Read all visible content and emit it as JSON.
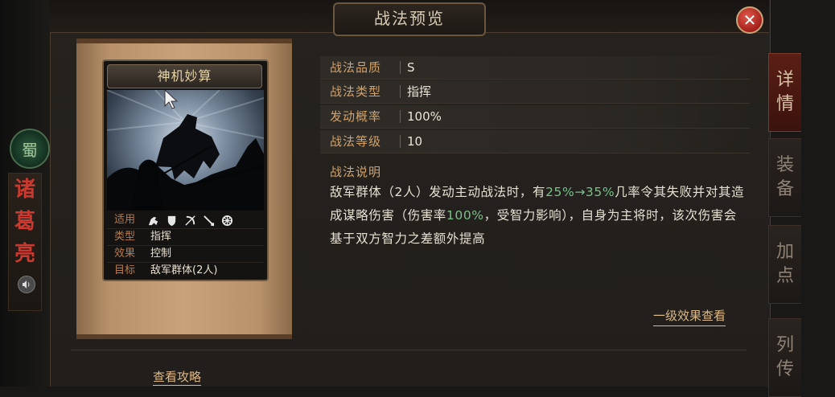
{
  "dialog": {
    "title": "战法预览",
    "close_icon": "close-icon"
  },
  "hero": {
    "faction_glyph": "蜀",
    "name_chars": [
      "诸",
      "葛",
      "亮"
    ],
    "voice_icon": "speaker-icon"
  },
  "side_tabs": [
    {
      "chars": [
        "详",
        "情"
      ],
      "active": true
    },
    {
      "chars": [
        "装",
        "备"
      ],
      "active": false
    },
    {
      "chars": [
        "加",
        "点"
      ],
      "active": false
    },
    {
      "chars": [
        "列",
        "传"
      ],
      "active": false
    }
  ],
  "skill_card": {
    "name": "神机妙算",
    "rows": [
      {
        "label": "适用",
        "icons": [
          "cavalry-icon",
          "shield-icon",
          "archer-icon",
          "spear-icon",
          "siege-icon"
        ]
      },
      {
        "label": "类型",
        "value": "指挥"
      },
      {
        "label": "效果",
        "value": "控制"
      },
      {
        "label": "目标",
        "value": "敌军群体(2人)"
      }
    ]
  },
  "properties": [
    {
      "label": "战法品质",
      "value": "S"
    },
    {
      "label": "战法类型",
      "value": "指挥"
    },
    {
      "label": "发动概率",
      "value": "100%"
    },
    {
      "label": "战法等级",
      "value": "10"
    }
  ],
  "description": {
    "heading": "战法说明",
    "part1": "敌军群体（2人）发动主动战法时，有",
    "highlight1": "25%→35%",
    "part2": "几率令其失败并对其造成谋略伤害（伤害率",
    "highlight2": "100%",
    "part3": "，受智力影响），自身为主将时，该次伤害会基于双方智力之差额外提高"
  },
  "links": {
    "effect_check": "一级效果查看",
    "guide": "查看攻略"
  },
  "colors": {
    "accent_gold": "#d2a269",
    "highlight_green": "#79c08a",
    "hero_red": "#c9392f"
  }
}
